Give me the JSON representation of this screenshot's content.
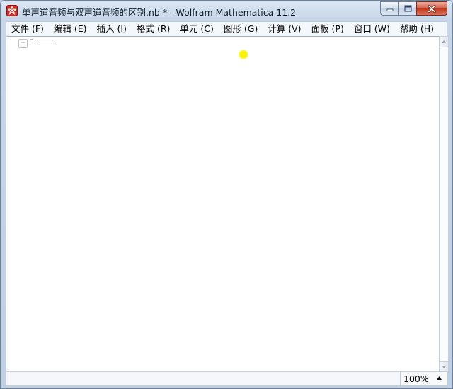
{
  "window": {
    "title": "单声道音频与双声道音频的区别.nb * - Wolfram Mathematica 11.2"
  },
  "menu": [
    {
      "label": "文件 (F)"
    },
    {
      "label": "编辑 (E)"
    },
    {
      "label": "插入 (I)"
    },
    {
      "label": "格式 (R)"
    },
    {
      "label": "单元 (C)"
    },
    {
      "label": "图形 (G)"
    },
    {
      "label": "计算 (V)"
    },
    {
      "label": "面板 (P)"
    },
    {
      "label": "窗口 (W)"
    },
    {
      "label": "帮助 (H)"
    }
  ],
  "notebook": {
    "cell_insert_symbol": "+"
  },
  "status": {
    "zoom": "100%"
  },
  "icons": {
    "app": "mathematica-spikey-icon",
    "minimize": "minimize-icon",
    "maximize": "maximize-icon",
    "close": "close-icon",
    "zoom_menu": "triangle-up-icon"
  },
  "colors": {
    "app_icon": "#d42a1f",
    "close_button": "#c2381f",
    "cursor_highlight": "#f6f300"
  }
}
